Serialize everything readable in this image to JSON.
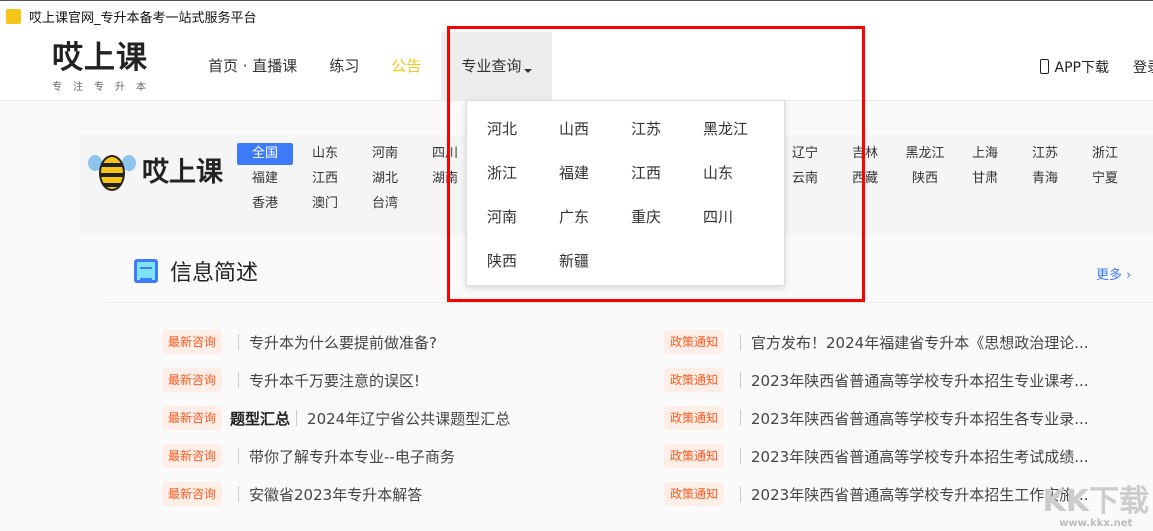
{
  "window": {
    "title": "哎上课官网_专升本备考一站式服务平台",
    "favicon_text": "哎上课"
  },
  "header": {
    "logo": "哎上课",
    "slogan": "专注专升本",
    "nav": [
      {
        "label": "首页 · 直播课"
      },
      {
        "label": "练习"
      },
      {
        "label": "公告"
      },
      {
        "label": "专业查询"
      }
    ],
    "app_download": "APP下载",
    "login": "登录"
  },
  "region": {
    "logo": "哎上课",
    "left_group": [
      "全国",
      "山东",
      "河南",
      "四川",
      "福建",
      "江西",
      "湖北",
      "湖南",
      "香港",
      "澳门",
      "台湾"
    ],
    "right_group": [
      "辽宁",
      "吉林",
      "黑龙江",
      "上海",
      "江苏",
      "浙江",
      "云南",
      "西藏",
      "陕西",
      "甘肃",
      "青海",
      "宁夏"
    ]
  },
  "dropdown": {
    "items": [
      "河北",
      "山西",
      "江苏",
      "黑龙江",
      "浙江",
      "福建",
      "江西",
      "山东",
      "河南",
      "广东",
      "重庆",
      "四川",
      "陕西",
      "新疆"
    ]
  },
  "info": {
    "title": "信息简述",
    "more": "更多",
    "left": [
      {
        "tag": "最新咨询",
        "text": "专升本为什么要提前做准备?"
      },
      {
        "tag": "最新咨询",
        "text": "专升本千万要注意的误区!"
      },
      {
        "tag": "最新咨询",
        "label": "题型汇总",
        "text": "2024年辽宁省公共课题型汇总"
      },
      {
        "tag": "最新咨询",
        "text": "带你了解专升本专业--电子商务"
      },
      {
        "tag": "最新咨询",
        "text": "安徽省2023年专升本解答"
      }
    ],
    "right": [
      {
        "tag": "政策通知",
        "text": "官方发布！2024年福建省专升本《思想政治理论..."
      },
      {
        "tag": "政策通知",
        "text": "2023年陕西省普通高等学校专升本招生专业课考..."
      },
      {
        "tag": "政策通知",
        "text": "2023年陕西省普通高等学校专升本招生各专业录..."
      },
      {
        "tag": "政策通知",
        "text": "2023年陕西省普通高等学校专升本招生考试成绩..."
      },
      {
        "tag": "政策通知",
        "text": "2023年陕西省普通高等学校专升本招生工作实施..."
      }
    ]
  },
  "watermark": {
    "logo": "KK下载",
    "url": "www.kkx.net"
  }
}
